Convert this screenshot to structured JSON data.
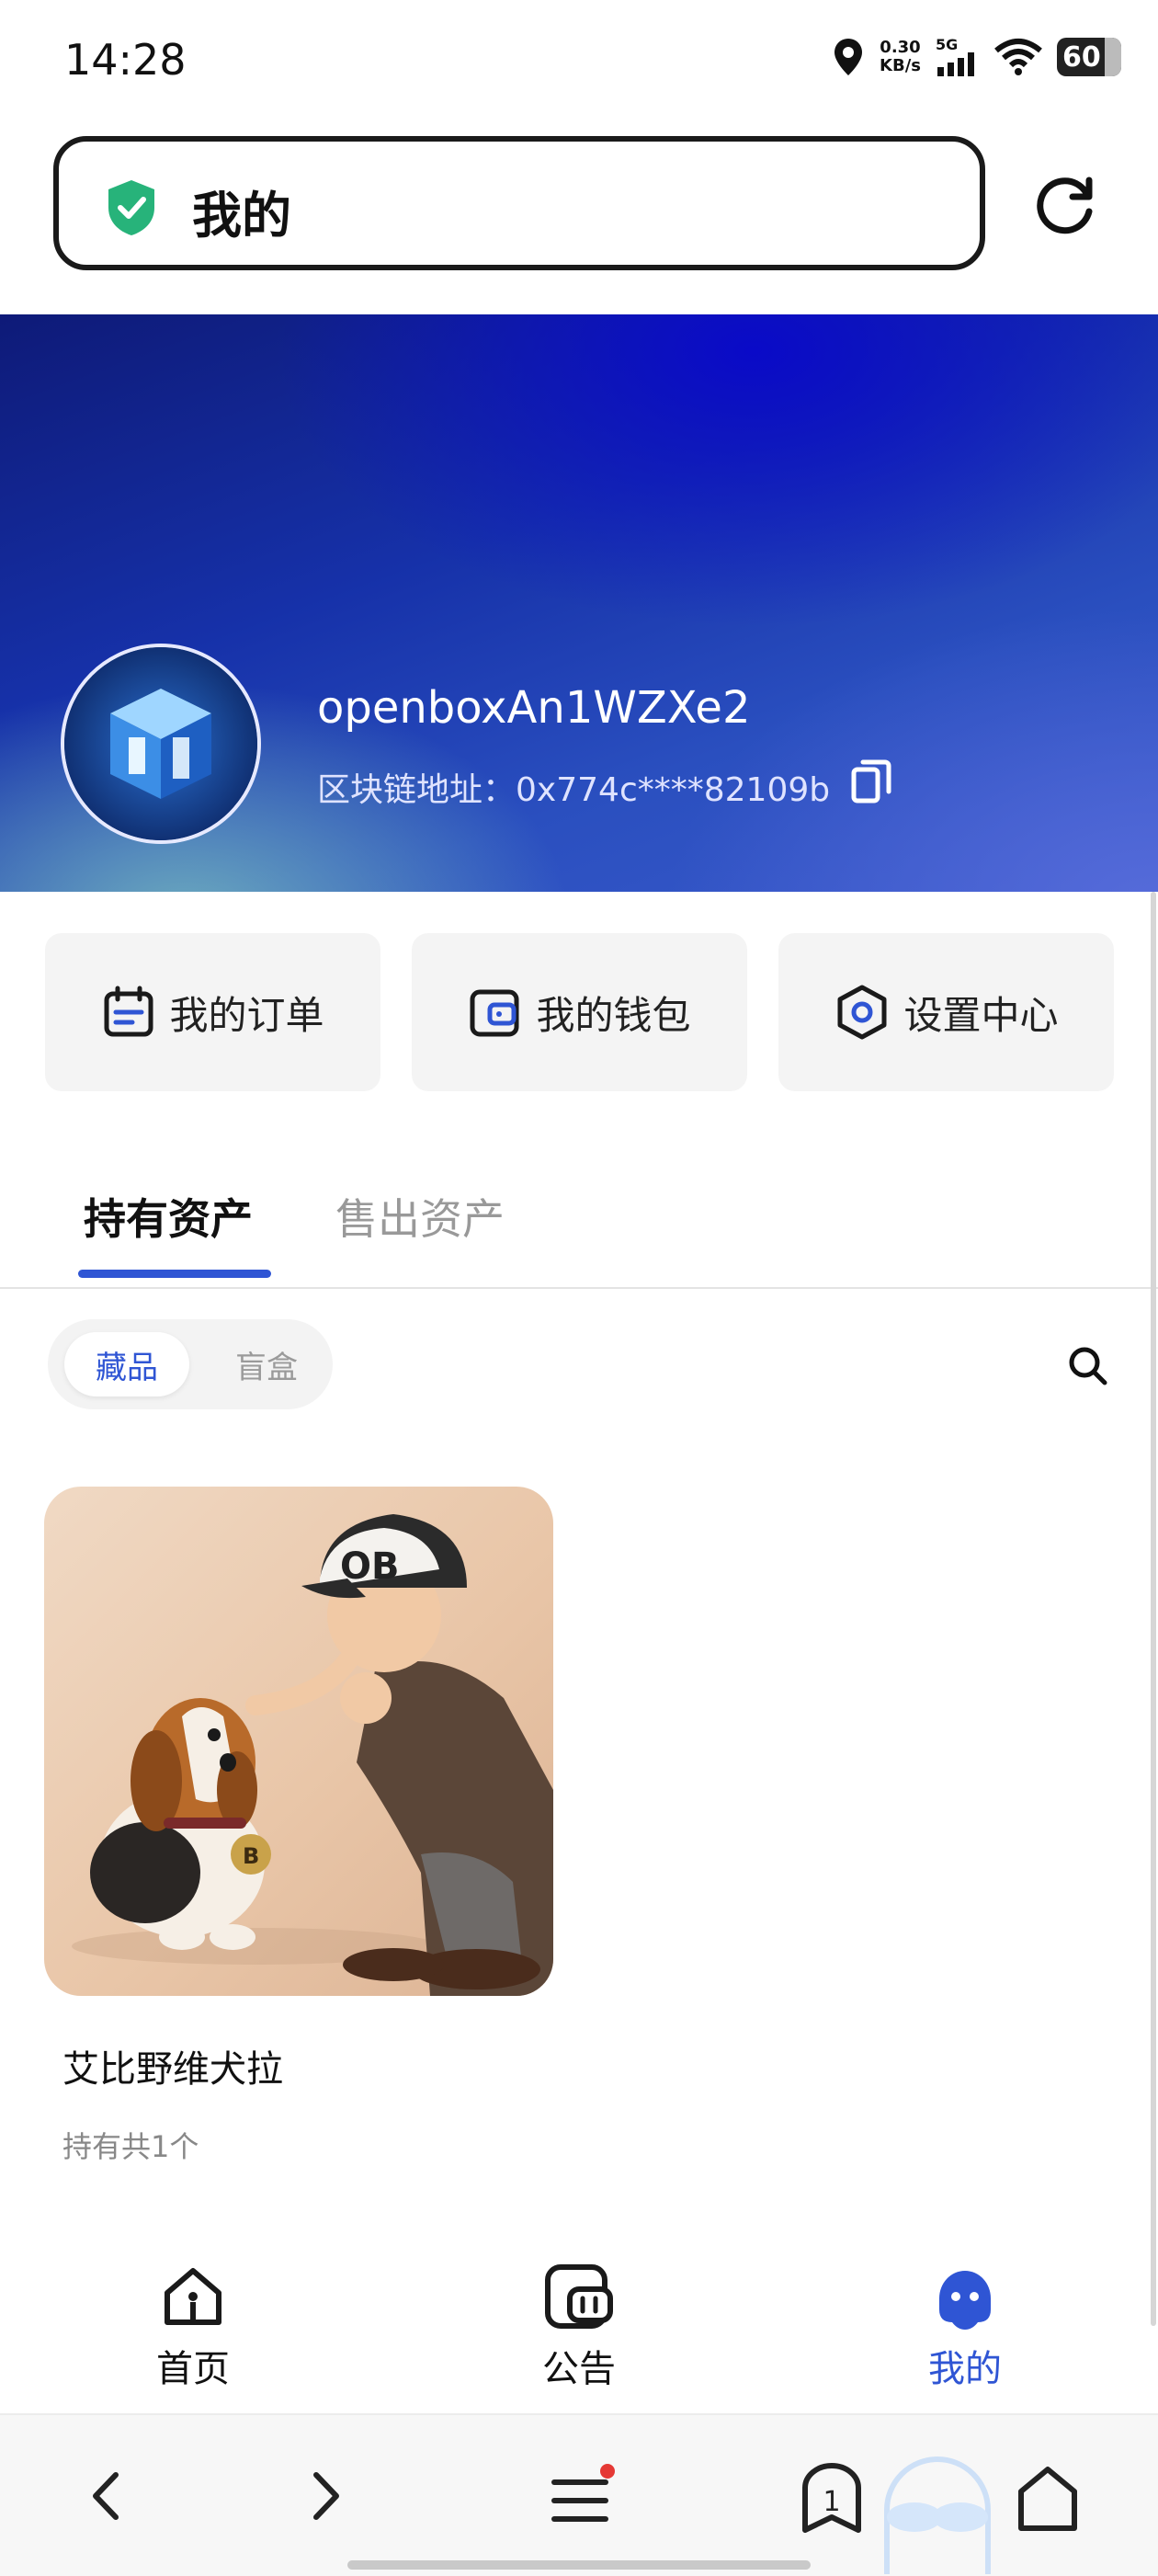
{
  "status": {
    "time": "14:28",
    "speed_value": "0.30",
    "speed_unit": "KB/s",
    "network": "5G",
    "battery": "60"
  },
  "address_bar": {
    "title": "我的"
  },
  "profile": {
    "username": "openboxAn1WZXe2",
    "chain_label": "区块链地址：",
    "chain_address": "0x774c****82109b"
  },
  "actions": [
    {
      "label": "我的订单",
      "icon": "calendar-icon"
    },
    {
      "label": "我的钱包",
      "icon": "wallet-icon"
    },
    {
      "label": "设置中心",
      "icon": "settings-hexagon-icon"
    }
  ],
  "tabs": [
    {
      "label": "持有资产",
      "active": true
    },
    {
      "label": "售出资产",
      "active": false
    }
  ],
  "filters": {
    "options": [
      "藏品",
      "盲盒"
    ],
    "selected": "藏品"
  },
  "items": [
    {
      "name": "艾比野维犬拉",
      "holding": "持有共1个",
      "cap_text": "OB",
      "tag_text": "B"
    }
  ],
  "app_nav": [
    {
      "label": "首页",
      "icon": "home-icon",
      "active": false
    },
    {
      "label": "公告",
      "icon": "announcement-icon",
      "active": false
    },
    {
      "label": "我的",
      "icon": "profile-ghost-icon",
      "active": true
    }
  ],
  "browser_bar": {
    "tab_count": "1"
  },
  "colors": {
    "accent": "#2f55d4",
    "hero_dark": "#0e1a78",
    "badge_dot": "#e53935"
  }
}
